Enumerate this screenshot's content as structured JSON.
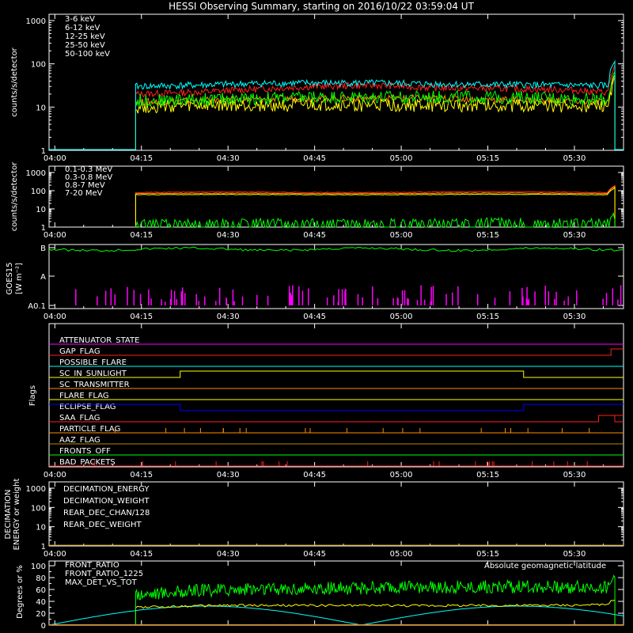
{
  "title": "HESSI Observing Summary, starting on 2016/10/22 03:59:04 UT",
  "time_ticks": [
    "04:00",
    "04:15",
    "04:30",
    "04:45",
    "05:00",
    "05:15",
    "05:30"
  ],
  "chart_data": [
    {
      "id": "panel1",
      "type": "line",
      "ylabel": "counts/s/detector",
      "yscale": "log",
      "ylim": [
        1,
        1000
      ],
      "yticks": [
        "1",
        "10",
        "100",
        "1000"
      ],
      "x_range_minutes": [
        0,
        46
      ],
      "data_start_minutes": 8.5,
      "data_end_minutes": 45,
      "series": [
        {
          "name": "3-6 keV",
          "color": "#ff2020",
          "x": [
            0,
            5,
            10,
            15,
            20,
            25,
            30,
            36,
            39,
            40
          ],
          "values": [
            20,
            22,
            26,
            30,
            32,
            28,
            27,
            25,
            22,
            22
          ]
        },
        {
          "name": "6-12 keV",
          "color": "#ff8c00",
          "x": [
            0,
            5,
            10,
            15,
            20,
            25,
            30,
            36,
            39,
            40
          ],
          "values": [
            13,
            14,
            15,
            16,
            16,
            16,
            15,
            14,
            13,
            13
          ]
        },
        {
          "name": "12-25 keV",
          "color": "#ffff00",
          "x": [
            0,
            5,
            10,
            15,
            20,
            25,
            30,
            36,
            39,
            40
          ],
          "values": [
            10,
            10.5,
            11,
            11,
            11,
            11,
            11,
            10.5,
            10,
            10
          ]
        },
        {
          "name": "25-50 keV",
          "color": "#00ff00",
          "x": [
            0,
            5,
            10,
            15,
            20,
            25,
            30,
            36,
            39,
            40
          ],
          "values": [
            14,
            15,
            16,
            17,
            17,
            17,
            17,
            16,
            15,
            15
          ]
        },
        {
          "name": "50-100 keV",
          "color": "#00ffff",
          "x": [
            0,
            5,
            10,
            15,
            20,
            25,
            30,
            36,
            39,
            40
          ],
          "values": [
            30,
            32,
            35,
            36,
            36,
            34,
            33,
            32,
            31,
            31
          ]
        }
      ]
    },
    {
      "id": "panel2",
      "type": "line",
      "ylabel": "counts/s/detector",
      "yscale": "log",
      "ylim": [
        1,
        1000
      ],
      "yticks": [
        "1",
        "10",
        "100",
        "1000"
      ],
      "series": [
        {
          "name": "0.1-0.3 MeV",
          "color": "#ff2020",
          "x": [
            0,
            5,
            10,
            15,
            20,
            25,
            30,
            36,
            39,
            40
          ],
          "values": [
            80,
            85,
            85,
            80,
            80,
            85,
            90,
            85,
            80,
            80
          ]
        },
        {
          "name": "0.3-0.8 MeV",
          "color": "#ff8c00",
          "x": [
            0,
            5,
            10,
            15,
            20,
            25,
            30,
            36,
            39,
            40
          ],
          "values": [
            70,
            72,
            72,
            70,
            70,
            72,
            75,
            72,
            70,
            70
          ]
        },
        {
          "name": "0.8-7 MeV",
          "color": "#ffff00",
          "x": [
            0,
            5,
            10,
            15,
            20,
            25,
            30,
            36,
            39,
            40
          ],
          "values": [
            60,
            62,
            62,
            60,
            60,
            62,
            64,
            62,
            60,
            60
          ]
        },
        {
          "name": "7-20 MeV",
          "color": "#00ff00",
          "x": [
            0,
            5,
            10,
            15,
            20,
            25,
            30,
            36,
            39,
            40
          ],
          "values": [
            1.5,
            1.6,
            1.7,
            1.6,
            1.6,
            1.7,
            1.8,
            1.7,
            1.6,
            1.6
          ]
        }
      ]
    },
    {
      "id": "panel3",
      "type": "line",
      "ylabel": "GOES15 [W m⁻²]",
      "ylabel_line1": "GOES15",
      "ylabel_line2": "[W m⁻²]",
      "yscale": "log",
      "yticks": [
        "A0.1",
        "A",
        "B"
      ],
      "series": [
        {
          "name": "GOES",
          "color": "#00ff00",
          "x": [
            0,
            10,
            20,
            30,
            46
          ],
          "values": [
            0.85,
            0.86,
            0.85,
            0.86,
            0.86
          ]
        }
      ]
    },
    {
      "id": "panel4",
      "type": "line",
      "ylabel": "Flags",
      "flags": [
        {
          "name": "ATTENUATOR_STATE",
          "color": "#ff00ff",
          "state": "off"
        },
        {
          "name": "GAP_FLAG",
          "color": "#ff2020",
          "state": "on-from",
          "from": 45
        },
        {
          "name": "POSSIBLE_FLARE",
          "color": "#00ffff",
          "state": "off"
        },
        {
          "name": "SC_IN_SUNLIGHT",
          "color": "#ffff00",
          "state": "on-between",
          "from": 10.5,
          "to": 38
        },
        {
          "name": "SC_TRANSMITTER",
          "color": "#ff8c00",
          "state": "off"
        },
        {
          "name": "FLARE_FLAG",
          "color": "#ffff00",
          "state": "off"
        },
        {
          "name": "ECLIPSE_FLAG",
          "color": "#0000ff",
          "state": "on-outside",
          "from": 10.5,
          "to": 38
        },
        {
          "name": "SAA_FLAG",
          "color": "#ff2020",
          "state": "on-from",
          "from": 44
        },
        {
          "name": "PARTICLE_FLAG",
          "color": "#ff8c00",
          "state": "spikes"
        },
        {
          "name": "AAZ_FLAG",
          "color": "#b8860b",
          "state": "off"
        },
        {
          "name": "FRONTS_OFF",
          "color": "#00ff00",
          "state": "off"
        },
        {
          "name": "BAD_PACKETS",
          "color": "#ff2020",
          "state": "spikes"
        }
      ]
    },
    {
      "id": "panel5",
      "type": "line",
      "ylabel": "DECIMATION ENERGY or weight",
      "ylabel_line1": "DECIMATION",
      "ylabel_line2": "ENERGY or weight",
      "yscale": "log",
      "ylim": [
        1,
        1000
      ],
      "yticks": [
        "1",
        "10",
        "100",
        "1000"
      ],
      "series": [
        {
          "name": "DECIMATION_ENERGY",
          "color": "#00ff00",
          "values": []
        },
        {
          "name": "DECIMATION_WEIGHT",
          "color": "#ff8c00",
          "values": []
        },
        {
          "name": "REAR_DEC_CHAN/128",
          "color": "#00ffff",
          "values": []
        },
        {
          "name": "REAR_DEC_WEIGHT",
          "color": "#b8860b",
          "values": []
        }
      ]
    },
    {
      "id": "panel6",
      "type": "line",
      "ylabel": "Degrees or %",
      "ylim": [
        0,
        100
      ],
      "yticks": [
        "0",
        "20",
        "40",
        "60",
        "80",
        "100"
      ],
      "annotation": "Absolute geomagnetic latitude",
      "annotation_color": "#00ffff",
      "series": [
        {
          "name": "FRONT_RATIO",
          "color": "#ffff00",
          "x": [
            8.5,
            15,
            25,
            35,
            45
          ],
          "values": [
            30,
            33,
            33,
            33,
            34
          ]
        },
        {
          "name": "FRONT_RATIO_1225",
          "color": "#00ff00",
          "x": [
            8.5,
            15,
            25,
            35,
            45
          ],
          "values": [
            52,
            60,
            62,
            65,
            63
          ]
        },
        {
          "name": "MAX_DET_VS_TOT",
          "color": "#ff8c00",
          "x": [
            0,
            46
          ],
          "values": [
            0,
            0
          ]
        },
        {
          "name": "Absolute geomagnetic latitude",
          "color": "#00ffff",
          "x": [
            0,
            11,
            24,
            36,
            46
          ],
          "values": [
            0,
            32,
            0,
            32,
            0
          ]
        }
      ]
    }
  ]
}
